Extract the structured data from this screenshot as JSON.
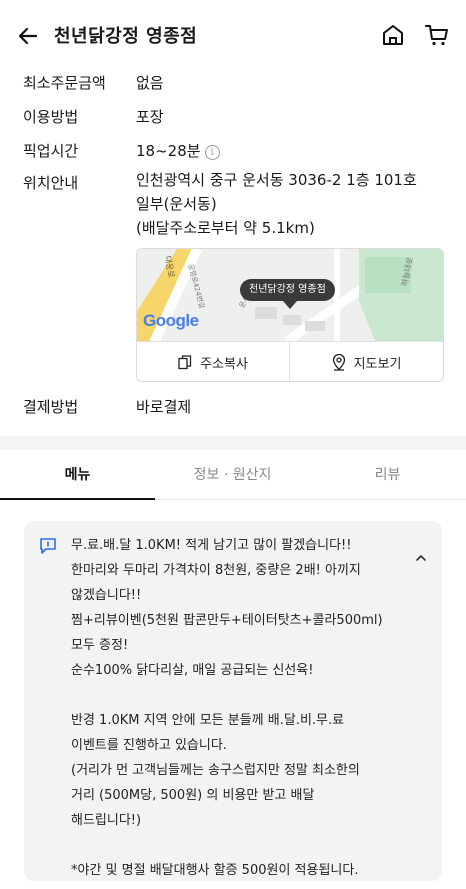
{
  "header": {
    "title": "천년닭강정 영종점"
  },
  "info": {
    "min_order_label": "최소주문금액",
    "min_order_value": "없음",
    "method_label": "이용방법",
    "method_value": "포장",
    "pickup_label": "픽업시간",
    "pickup_value": "18~28분",
    "location_label": "위치안내",
    "address_line1": "인천광역시 중구 운서동 3036-2 1층 101호",
    "address_line2": "일부(운서동)",
    "distance": "(배달주소로부터 약 5.1km)",
    "payment_label": "결제방법",
    "payment_value": "바로결제"
  },
  "map": {
    "marker_label": "천년닭강정 영종점",
    "google_logo": "Google",
    "road_label_left": "대운로",
    "road_label_top": "공항로424번길",
    "road_label_right": "하늘대로",
    "road_label_small": "운서동",
    "copy_address": "주소복사",
    "view_map": "지도보기"
  },
  "tabs": [
    {
      "label": "메뉴",
      "active": true
    },
    {
      "label": "정보 · 원산지",
      "active": false
    },
    {
      "label": "리뷰",
      "active": false
    }
  ],
  "notice": {
    "lines": [
      "무.료.배.달 1.0KM! 적게 남기고 많이 팔겠습니다!!",
      "한마리와 두마리 가격차이 8천원, 중량은 2배! 아끼지",
      "않겠습니다!!",
      "찜+리뷰이벤(5천원 팝콘만두+테이터탓츠+콜라500ml)",
      "모두 증정!",
      "순수100% 닭다리살, 매일 공급되는 신선육!",
      "",
      "반경 1.0KM 지역 안에 모든 분들께 배.달.비.무.료",
      "이벤트를 진행하고 있습니다.",
      "(거리가 먼 고객님들께는 송구스럽지만 정말 최소한의",
      "거리 (500M당, 500원) 의 비용만 받고 배달",
      "해드립니다!)",
      "",
      "*야간 및 명절 배달대행사 할증 500원이 적용됩니다."
    ]
  },
  "colors": {
    "accent_blue": "#2b6fe8",
    "map_tooltip_bg": "#3a3a3a",
    "road_yellow": "#f6d56a",
    "park_green": "#c9e8cf"
  }
}
